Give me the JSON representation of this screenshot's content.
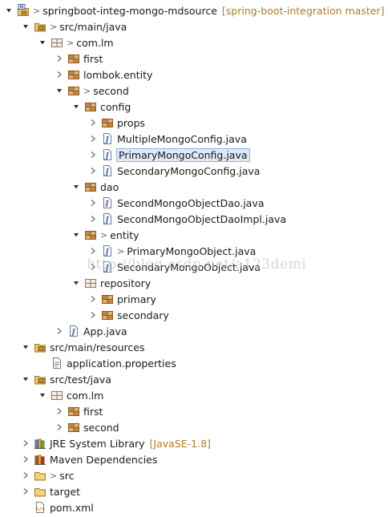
{
  "project_explorer": {
    "rows": [
      {
        "label": "springboot-integ-mongo-mdsource",
        "decoration": "[spring-boot-integration master]",
        "icon": "maven-project-icon",
        "depth": 0,
        "expanded": true,
        "dirty": true
      },
      {
        "label": "src/main/java",
        "icon": "source-folder-icon",
        "depth": 1,
        "expanded": true,
        "dirty": true
      },
      {
        "label": "com.lm",
        "icon": "package-empty-icon",
        "depth": 2,
        "expanded": true,
        "dirty": true
      },
      {
        "label": "first",
        "icon": "package-icon",
        "depth": 3,
        "expanded": false
      },
      {
        "label": "lombok.entity",
        "icon": "package-icon",
        "depth": 3,
        "expanded": false
      },
      {
        "label": "second",
        "icon": "package-icon",
        "depth": 3,
        "expanded": true,
        "dirty": true
      },
      {
        "label": "config",
        "icon": "package-icon",
        "depth": 4,
        "expanded": true
      },
      {
        "label": "props",
        "icon": "package-icon",
        "depth": 5,
        "expanded": false
      },
      {
        "label": "MultipleMongoConfig.java",
        "icon": "java-file-icon",
        "depth": 5,
        "expanded": false
      },
      {
        "label": "PrimaryMongoConfig.java",
        "icon": "java-file-icon",
        "depth": 5,
        "expanded": false,
        "selected": true
      },
      {
        "label": "SecondaryMongoConfig.java",
        "icon": "java-file-icon",
        "depth": 5,
        "expanded": false
      },
      {
        "label": "dao",
        "icon": "package-icon",
        "depth": 4,
        "expanded": true
      },
      {
        "label": "SecondMongoObjectDao.java",
        "icon": "java-interface-file-icon",
        "depth": 5,
        "expanded": false
      },
      {
        "label": "SecondMongoObjectDaoImpl.java",
        "icon": "java-file-icon",
        "depth": 5,
        "expanded": false
      },
      {
        "label": "entity",
        "icon": "package-icon",
        "depth": 4,
        "expanded": true,
        "dirty": true
      },
      {
        "label": "PrimaryMongoObject.java",
        "icon": "java-file-icon",
        "depth": 5,
        "expanded": false,
        "dirty": true
      },
      {
        "label": "SecondaryMongoObject.java",
        "icon": "java-file-icon",
        "depth": 5,
        "expanded": false
      },
      {
        "label": "repository",
        "icon": "package-empty-icon",
        "depth": 4,
        "expanded": true
      },
      {
        "label": "primary",
        "icon": "package-icon",
        "depth": 5,
        "expanded": false
      },
      {
        "label": "secondary",
        "icon": "package-icon",
        "depth": 5,
        "expanded": false
      },
      {
        "label": "App.java",
        "icon": "java-file-icon",
        "depth": 3,
        "expanded": false
      },
      {
        "label": "src/main/resources",
        "icon": "source-folder-icon",
        "depth": 1,
        "expanded": true
      },
      {
        "label": "application.properties",
        "icon": "properties-file-icon",
        "depth": 2,
        "leaf": true
      },
      {
        "label": "src/test/java",
        "icon": "source-folder-icon",
        "depth": 1,
        "expanded": true
      },
      {
        "label": "com.lm",
        "icon": "package-empty-icon",
        "depth": 2,
        "expanded": true
      },
      {
        "label": "first",
        "icon": "package-icon",
        "depth": 3,
        "expanded": false
      },
      {
        "label": "second",
        "icon": "package-icon",
        "depth": 3,
        "expanded": false
      },
      {
        "label": "JRE System Library",
        "decoration": "[JavaSE-1.8]",
        "icon": "library-icon",
        "depth": 1,
        "expanded": false
      },
      {
        "label": "Maven Dependencies",
        "icon": "maven-library-icon",
        "depth": 1,
        "expanded": false
      },
      {
        "label": "src",
        "icon": "folder-icon",
        "depth": 1,
        "expanded": false,
        "dirty": true
      },
      {
        "label": "target",
        "icon": "folder-icon",
        "depth": 1,
        "expanded": false
      },
      {
        "label": "pom.xml",
        "icon": "xml-file-icon",
        "depth": 1,
        "leaf": true
      }
    ]
  },
  "watermark": {
    "text": "http://blog.csdn.net/a123demi"
  },
  "colors": {
    "decoration": "#b07a2a",
    "selection_bg": "#dce9f9",
    "package": "#b5651d",
    "java_j": "#4a78b5"
  }
}
